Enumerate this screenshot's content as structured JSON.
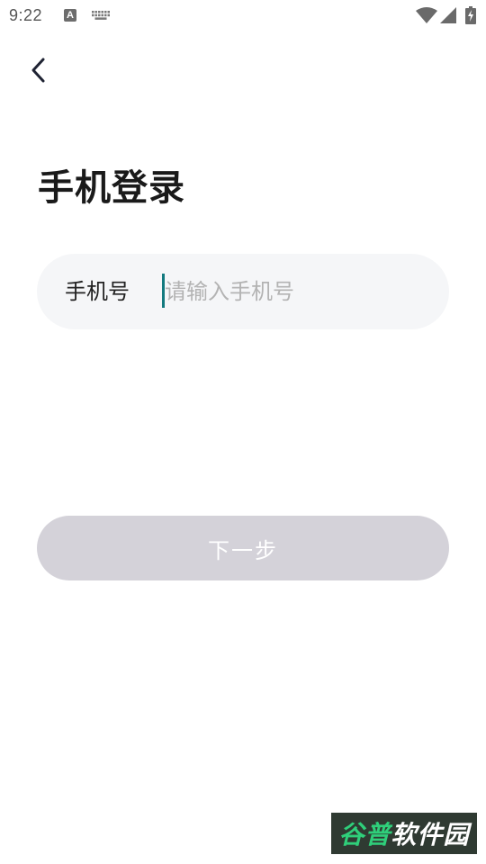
{
  "status_bar": {
    "time": "9:22",
    "icons": [
      "a-badge-icon",
      "keyboard-icon",
      "wifi-icon",
      "signal-icon",
      "battery-charging-icon"
    ],
    "a_icon_label": "A"
  },
  "header": {
    "back_icon": "chevron-left-icon",
    "title": "手机登录"
  },
  "form": {
    "phone_label": "手机号",
    "phone_value": "",
    "phone_placeholder": "请输入手机号",
    "next_label": "下一步"
  },
  "colors": {
    "cursor": "#137a7f",
    "field_background": "#f5f6f8",
    "button_disabled": "#d4d2d9",
    "watermark_accent": "#2fcf7a"
  },
  "watermark": {
    "part1": "谷普",
    "part2": "软件园"
  }
}
